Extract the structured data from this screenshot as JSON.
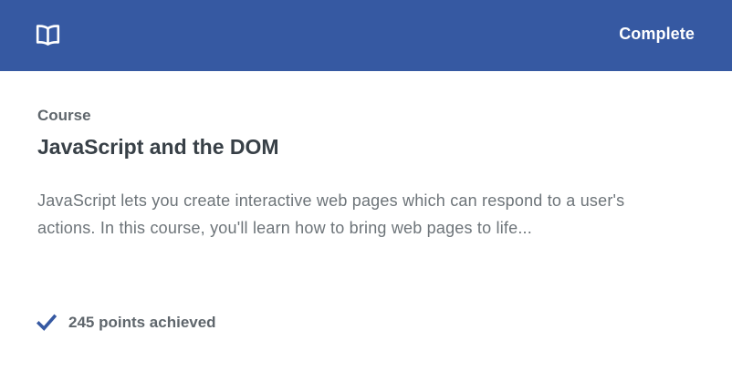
{
  "header": {
    "icon": "book-icon",
    "status_label": "Complete",
    "background_color": "#3659a2"
  },
  "content": {
    "kind": "Course",
    "title": "JavaScript and the DOM",
    "description": "JavaScript lets you create interactive web pages which can respond to a user's actions. In this course, you'll learn how to bring web pages to life..."
  },
  "footer": {
    "icon": "checkmark-icon",
    "points_label": "245 points achieved",
    "accent_color": "#3659a2"
  }
}
